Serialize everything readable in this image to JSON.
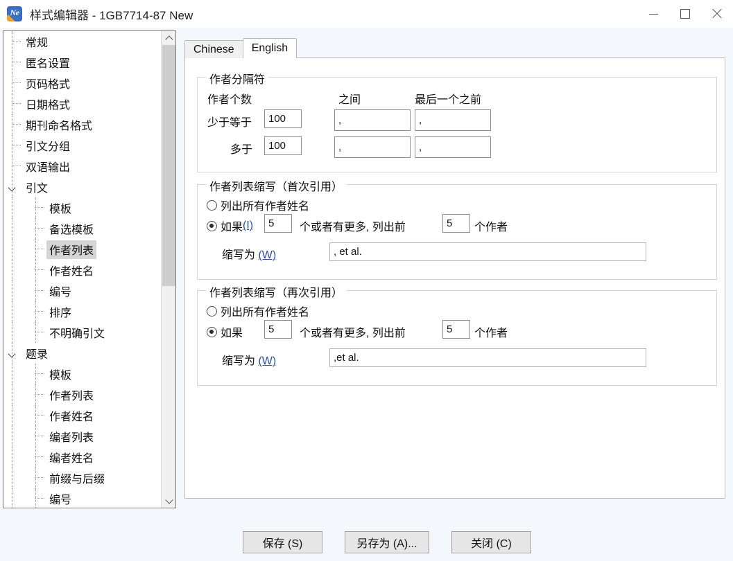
{
  "window": {
    "title": "样式编辑器 - 1GB7714-87 New",
    "icon_label": "Ne",
    "minimize_label": "最小化",
    "maximize_label": "最大化",
    "close_label": "关闭"
  },
  "tree": {
    "items": [
      {
        "label": "常规",
        "depth": 1,
        "expander": false,
        "selected": false
      },
      {
        "label": "匿名设置",
        "depth": 1,
        "expander": false,
        "selected": false
      },
      {
        "label": "页码格式",
        "depth": 1,
        "expander": false,
        "selected": false
      },
      {
        "label": "日期格式",
        "depth": 1,
        "expander": false,
        "selected": false
      },
      {
        "label": "期刊命名格式",
        "depth": 1,
        "expander": false,
        "selected": false
      },
      {
        "label": "引文分组",
        "depth": 1,
        "expander": false,
        "selected": false
      },
      {
        "label": "双语输出",
        "depth": 1,
        "expander": false,
        "selected": false
      },
      {
        "label": "引文",
        "depth": 1,
        "expander": true,
        "selected": false
      },
      {
        "label": "模板",
        "depth": 2,
        "expander": false,
        "selected": false
      },
      {
        "label": "备选模板",
        "depth": 2,
        "expander": false,
        "selected": false
      },
      {
        "label": "作者列表",
        "depth": 2,
        "expander": false,
        "selected": true
      },
      {
        "label": "作者姓名",
        "depth": 2,
        "expander": false,
        "selected": false
      },
      {
        "label": "编号",
        "depth": 2,
        "expander": false,
        "selected": false
      },
      {
        "label": "排序",
        "depth": 2,
        "expander": false,
        "selected": false
      },
      {
        "label": "不明确引文",
        "depth": 2,
        "expander": false,
        "selected": false
      },
      {
        "label": "题录",
        "depth": 1,
        "expander": true,
        "selected": false
      },
      {
        "label": "模板",
        "depth": 2,
        "expander": false,
        "selected": false
      },
      {
        "label": "作者列表",
        "depth": 2,
        "expander": false,
        "selected": false
      },
      {
        "label": "作者姓名",
        "depth": 2,
        "expander": false,
        "selected": false
      },
      {
        "label": "编者列表",
        "depth": 2,
        "expander": false,
        "selected": false
      },
      {
        "label": "编者姓名",
        "depth": 2,
        "expander": false,
        "selected": false
      },
      {
        "label": "前缀与后缀",
        "depth": 2,
        "expander": false,
        "selected": false
      },
      {
        "label": "编号",
        "depth": 2,
        "expander": false,
        "selected": false
      }
    ],
    "scroll_up_icon": "chevron-up-icon",
    "scroll_down_icon": "chevron-down-icon"
  },
  "tabs": [
    {
      "label": "Chinese",
      "active": false
    },
    {
      "label": "English",
      "active": true
    }
  ],
  "separator_group": {
    "title": "作者分隔符",
    "col_count_label": "作者个数",
    "col_between_label": "之间",
    "col_before_last_label": "最后一个之前",
    "rows": [
      {
        "row_label": "少于等于",
        "count": "100",
        "between": ",",
        "before_last": ","
      },
      {
        "row_label": "多于",
        "count": "100",
        "between": ",",
        "before_last": ","
      }
    ]
  },
  "first_citation_group": {
    "title": "作者列表缩写（首次引用）",
    "option_all_label": "列出所有作者姓名",
    "option_all_selected": false,
    "option_abbrev_selected": true,
    "if_label": "如果",
    "if_mnemonic": "(I)",
    "threshold": "5",
    "mid_label": "个或者有更多, 列出前",
    "show_count": "5",
    "authors_suffix_label": "个作者",
    "abbrev_label": "缩写为",
    "abbrev_mnemonic": "(W)",
    "abbrev_value": ", et al."
  },
  "repeat_citation_group": {
    "title": "作者列表缩写（再次引用）",
    "option_all_label": "列出所有作者姓名",
    "option_all_selected": false,
    "option_abbrev_selected": true,
    "if_label": "如果",
    "if_mnemonic": "",
    "threshold": "5",
    "mid_label": "个或者有更多, 列出前",
    "show_count": "5",
    "authors_suffix_label": "个作者",
    "abbrev_label": "缩写为",
    "abbrev_mnemonic": "(W)",
    "abbrev_value": ",et al."
  },
  "footer": {
    "save_label": "保存 (S)",
    "save_as_label": "另存为 (A)...",
    "close_label": "关闭 (C)"
  },
  "colors": {
    "dialog_background": "#f4f8fd",
    "panel_background": "#ffffff",
    "selection": "#d5d5d5",
    "accent": "#3a6fc4"
  }
}
